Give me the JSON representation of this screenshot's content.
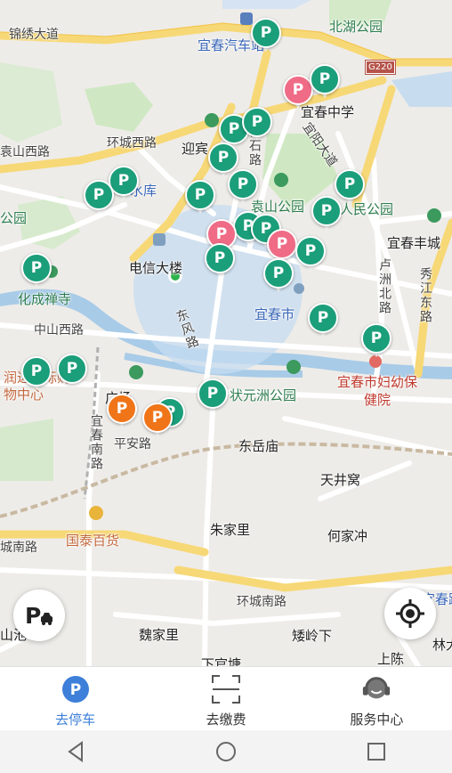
{
  "map": {
    "labels": {
      "jinxiu_avenue": "锦绣大道",
      "yichun_bus_station": "宜春汽车站",
      "beihu_park": "北湖公园",
      "g220": "G220",
      "yichun_middle_school": "宜春中学",
      "yuanshan_west_rd": "袁山西路",
      "huancheng_west_rd": "环城西路",
      "yingbin": "迎宾",
      "reservoir": "水库",
      "jieshi_road": "界石路",
      "fuqiao_avenue": "宜阳大道",
      "yuanshan_park": "袁山公园",
      "renmin_park": "人民公园",
      "yichun_fengcheng": "宜春丰城",
      "park_left": "公园",
      "telecom_building": "电信大楼",
      "luzhou_north_rd": "卢洲北路",
      "xiujiang_east_rd": "秀江东路",
      "huacheng_temple": "化成禅寺",
      "zhongshan_west_rd": "中山西路",
      "dongfeng_rd": "东风路",
      "yichun_city": "宜春市",
      "runda_mall": "润达国际购物中心",
      "maternal_hospital": "宜春市妇幼保健院",
      "zhuangyuanzhou_park": "状元洲公园",
      "yichun_south_rd": "宜春南路",
      "pingan_rd": "平安路",
      "dongyue_temple": "东岳庙",
      "tianjingwo": "天井窝",
      "zhujiali": "朱家里",
      "hejiachong": "何家冲",
      "guotai_store": "国泰百货",
      "chengnan_rd": "城南路",
      "huancheng_south_rd": "环城南路",
      "weijiali": "魏家里",
      "ailingxia": "矮岭下",
      "xiagongtang": "下官塘",
      "shangchen": "上陈",
      "linda": "林大",
      "shanchi": "山池",
      "square": "广场",
      "yichun_lu": "宜春路"
    },
    "markers": [
      {
        "type": "green",
        "label": "P"
      },
      {
        "type": "pink",
        "label": "P"
      },
      {
        "type": "green",
        "label": "P"
      },
      {
        "type": "green",
        "label": "P"
      },
      {
        "type": "green",
        "label": "P"
      },
      {
        "type": "green",
        "label": "P"
      },
      {
        "type": "green",
        "label": "P"
      },
      {
        "type": "green",
        "label": "P"
      },
      {
        "type": "green",
        "label": "P"
      },
      {
        "type": "green",
        "label": "P"
      },
      {
        "type": "green",
        "label": "P"
      },
      {
        "type": "green",
        "label": "P"
      },
      {
        "type": "green",
        "label": "P"
      },
      {
        "type": "green",
        "label": "P"
      },
      {
        "type": "pink",
        "label": "P"
      },
      {
        "type": "green",
        "label": "P"
      },
      {
        "type": "pink",
        "label": "P"
      },
      {
        "type": "green",
        "label": "P"
      },
      {
        "type": "green",
        "label": "P"
      },
      {
        "type": "green",
        "label": "P"
      },
      {
        "type": "green",
        "label": "P"
      },
      {
        "type": "green",
        "label": "P"
      },
      {
        "type": "green",
        "label": "P"
      },
      {
        "type": "green",
        "label": "P"
      },
      {
        "type": "green",
        "label": "P"
      },
      {
        "type": "orange",
        "label": "P"
      },
      {
        "type": "orange",
        "label": "P"
      },
      {
        "type": "green",
        "label": "P"
      }
    ],
    "buttons": {
      "parking_icon": "parking-car-icon",
      "locate_icon": "locate-crosshair-icon"
    }
  },
  "tabbar": {
    "tabs": [
      {
        "label": "去停车",
        "icon": "parking-icon",
        "active": true
      },
      {
        "label": "去缴费",
        "icon": "scan-icon",
        "active": false
      },
      {
        "label": "服务中心",
        "icon": "headset-icon",
        "active": false
      }
    ]
  },
  "colors": {
    "accent": "#3d7fd9",
    "marker_green": "#1b9e7a",
    "marker_pink": "#ef6b86",
    "marker_orange": "#f07418"
  }
}
